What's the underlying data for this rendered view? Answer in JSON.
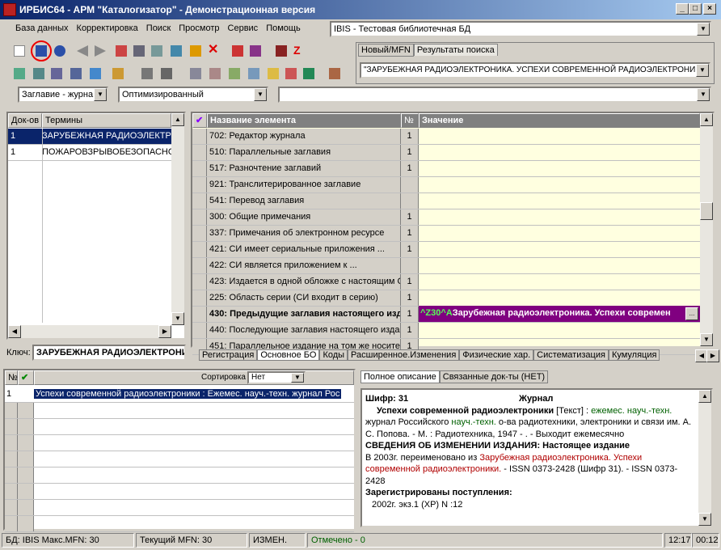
{
  "window": {
    "title": "ИРБИС64 - АРМ \"Каталогизатор\" - Демонстрационная версия"
  },
  "menu": [
    "База данных",
    "Корректировка",
    "Поиск",
    "Просмотр",
    "Сервис",
    "Помощь"
  ],
  "db_select": "IBIS - Тестовая библиотечная БД",
  "right_tabs": [
    "Новый/MFN",
    "Результаты поиска"
  ],
  "search_query": "\"ЗАРУБЕЖНАЯ РАДИОЭЛЕКТРОНИКА. УСПЕХИ СОВРЕМЕННОЙ РАДИОЭЛЕКТРОНИКИ\" (За",
  "search_combo1": "Заглавие - журна",
  "search_combo2": "Оптимизированный",
  "terms": {
    "col_docs": "Док-ов",
    "col_terms": "Термины",
    "rows": [
      {
        "n": "1",
        "term": "ЗАРУБЕЖНАЯ РАДИОЭЛЕКТР"
      },
      {
        "n": "1",
        "term": "ПОЖАРОВЗРЫВОБЕЗОПАСНО"
      }
    ],
    "key_label": "Ключ:",
    "key_value": "ЗАРУБЕЖНАЯ РАДИОЭЛЕКТРОНИ"
  },
  "fields": {
    "col_name": "Название элемента",
    "col_num": "№",
    "col_value": "Значение",
    "rows": [
      {
        "name": "702: Редактор журнала",
        "n": "1"
      },
      {
        "name": "510: Параллельные заглавия",
        "n": "1"
      },
      {
        "name": "517: Разночтение заглавий",
        "n": "1"
      },
      {
        "name": "921: Транслитерированное заглавие",
        "n": ""
      },
      {
        "name": "541: Перевод заглавия",
        "n": ""
      },
      {
        "name": "300: Общие примечания",
        "n": "1"
      },
      {
        "name": "337: Примечания об электронном ресурсе",
        "n": "1"
      },
      {
        "name": "421: СИ имеет сериальные приложения ...",
        "n": "1"
      },
      {
        "name": "422: СИ является приложением к ...",
        "n": ""
      },
      {
        "name": "423: Издается в одной обложке с настоящим С",
        "n": "1"
      },
      {
        "name": "225: Область серии (СИ входит в серию)",
        "n": "1"
      },
      {
        "name": "430: Предыдущие заглавия настоящего изд",
        "n": "1"
      },
      {
        "name": "440: Последующие заглавия настоящего издан",
        "n": "1"
      },
      {
        "name": "451: Параллельное издание на том же носите",
        "n": "1"
      }
    ],
    "edit_value_prefix": "^Z30^A",
    "edit_value": "Зарубежная радиоэлектроника. Успехи современ"
  },
  "worksheet_tabs": [
    "Регистрация",
    "Основное БО",
    "Коды",
    "Расширенное.Изменения",
    "Физические хар.",
    "Систематизация",
    "Кумуляция"
  ],
  "results": {
    "col_num": "№",
    "sort_label": "Сортировка",
    "sort_value": "Нет",
    "rows": [
      {
        "n": "1",
        "text": "Успехи современной радиоэлектроники : Ежемес. науч.-техн. журнал Рос"
      }
    ]
  },
  "desc_tabs": [
    "Полное описание",
    "Связанные док-ты (НЕТ)"
  ],
  "description": {
    "shifr": "Шифр: 31",
    "type": "Журнал",
    "title": "Успехи современной радиоэлектроники",
    "l1b": " [Текст] : ",
    "l1c": "ежемес. науч.-техн.",
    "l2a": "журнал Российского ",
    "l2b": "науч.-техн.",
    "l2c": " о-ва радиотехники, электроники и связи им. А.",
    "l3": "С. Попова. - М. : Радиотехника, 1947 -       . - Выходит ежемесячно",
    "h1": "СВЕДЕНИЯ ОБ ИЗМЕНЕНИИ ИЗДАНИЯ: Настоящее издание",
    "l4a": "В 2003г. переименовано из ",
    "l4b": "Зарубежная радиоэлектроника. Успехи",
    "l5a": "современной радиоэлектроники.",
    "l5b": " - ISSN 0373-2428 (Шифр 31). - ISSN 0373-2428",
    "h2": "Зарегистрированы поступления:",
    "l6": "2002г. экз.1 (ХР) N :12"
  },
  "status": {
    "db": "БД: IBIS Макс.MFN: 30",
    "mfn": "Текущий MFN: 30",
    "changed": "ИЗМЕН.",
    "marked": "Отмечено - 0",
    "time": "12:17",
    "time2": "00:12"
  },
  "colors": {
    "title_bar": "#0a246a",
    "selection": "#0a246a",
    "edit_row": "#800080",
    "value_bg": "#ffffe0"
  }
}
